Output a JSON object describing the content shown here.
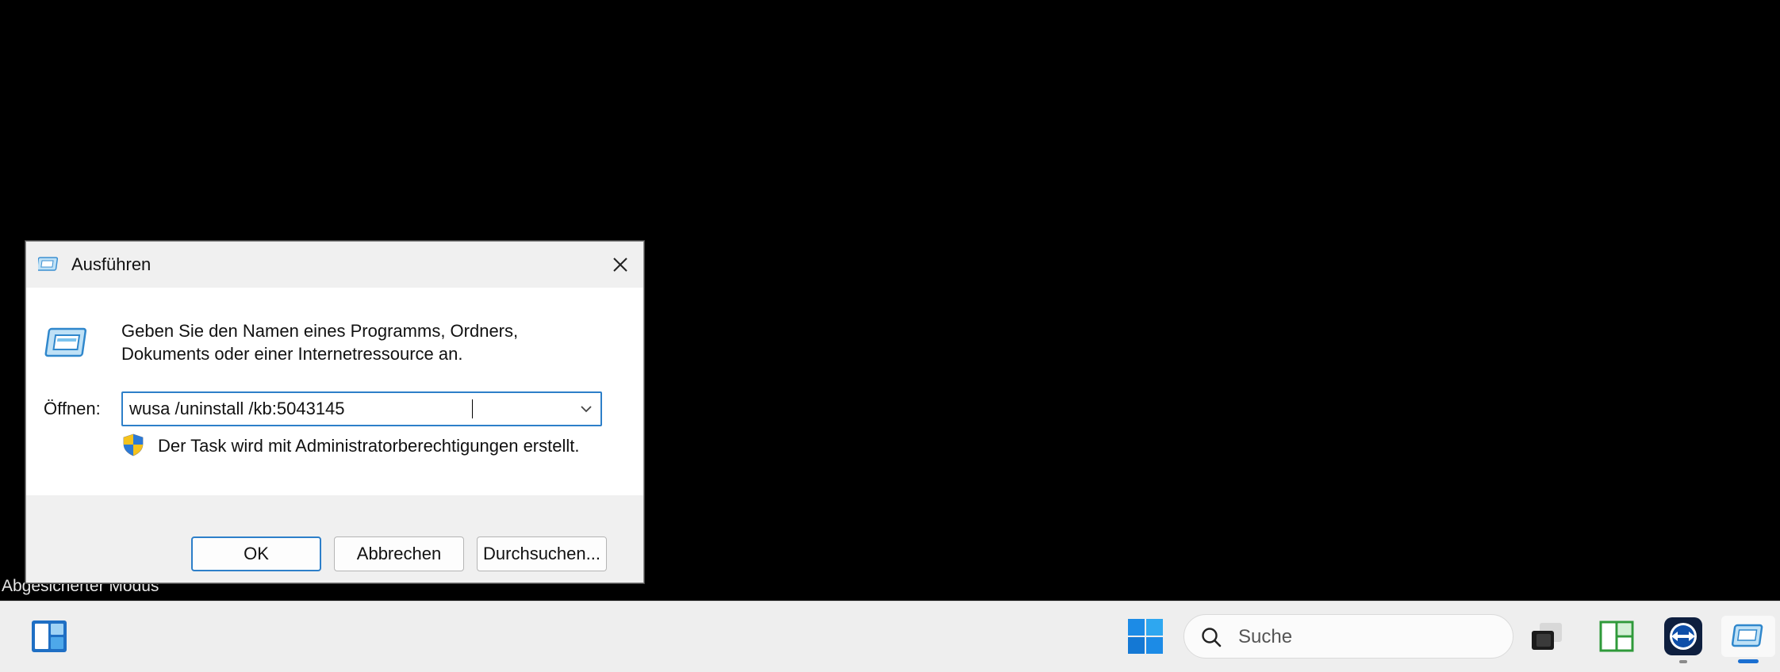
{
  "desktop": {
    "mode_label": "Abgesicherter Modus"
  },
  "run_dialog": {
    "title": "Ausführen",
    "description_line1": "Geben Sie den Namen eines Programms, Ordners,",
    "description_line2": "Dokuments oder einer Internetressource an.",
    "open_label": "Öffnen:",
    "open_value": "wusa /uninstall /kb:5043145",
    "admin_note": "Der Task wird mit Administratorberechtigungen erstellt.",
    "buttons": {
      "ok": "OK",
      "cancel": "Abbrechen",
      "browse": "Durchsuchen..."
    },
    "icons": {
      "title": "run-icon",
      "body": "run-icon",
      "admin": "uac-shield-icon",
      "close": "close-icon",
      "dropdown": "chevron-down-icon"
    }
  },
  "taskbar": {
    "search_placeholder": "Suche",
    "items": [
      "widgets-icon",
      "windows-start-icon",
      "search-icon",
      "task-view-icon",
      "layout-app-icon",
      "teamviewer-icon",
      "run-task-icon"
    ]
  },
  "colors": {
    "accent": "#2d7fc9",
    "dialog_bg": "#ffffff",
    "dialog_footer": "#f0f0f0",
    "taskbar_bg": "#eeeeee",
    "desktop_bg": "#000000"
  }
}
